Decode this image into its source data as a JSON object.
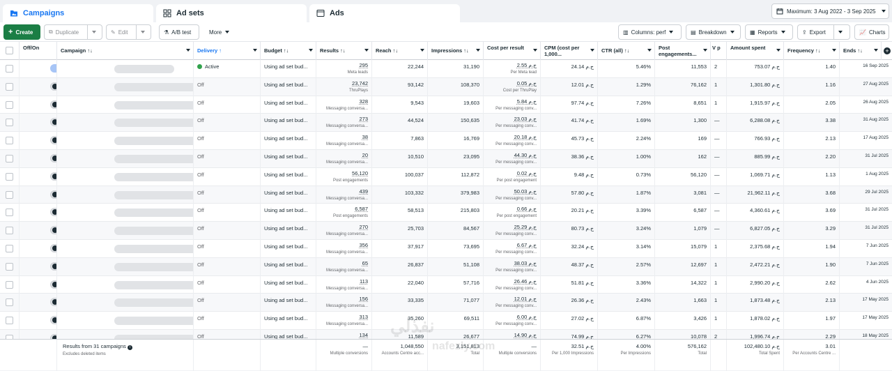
{
  "tabs": [
    {
      "label": "Campaigns",
      "icon": "folder-icon"
    },
    {
      "label": "Ad sets",
      "icon": "grid-icon"
    },
    {
      "label": "Ads",
      "icon": "ad-icon"
    }
  ],
  "date_range": "Maximum: 3 Aug 2022 - 3 Sep 2025",
  "toolbar": {
    "create": "Create",
    "duplicate": "Duplicate",
    "edit": "Edit",
    "ab_test": "A/B test",
    "more": "More",
    "columns": "Columns: perf",
    "breakdown": "Breakdown",
    "reports": "Reports",
    "export": "Export",
    "charts": "Charts"
  },
  "headers": {
    "offon": "Off/On",
    "campaign": "Campaign ↑↓",
    "delivery": "Delivery ↑",
    "budget": "Budget ↑↓",
    "results": "Results ↑↓",
    "reach": "Reach ↑↓",
    "impressions": "Impressions ↑↓",
    "cpr": "Cost per result",
    "cpm": "CPM (cost per 1,000...",
    "ctr": "CTR (all) ↑↓",
    "pe": "Post engagements...",
    "v": "V p",
    "spent": "Amount spent",
    "freq": "Frequency ↑↓",
    "ends": "Ends ↑↓"
  },
  "rows": [
    {
      "on": true,
      "delivery": "Active",
      "budget": "Using ad set bud...",
      "results": "295",
      "rsub": "Meta leads",
      "reach": "22,244",
      "impr": "31,190",
      "cpr": "2.55 ج.م",
      "cprsub": "Per Meta lead",
      "cpm": "24.14 ج.م",
      "ctr": "5.46%",
      "pe": "11,553",
      "v": "2",
      "spent": "753.07 ج.م",
      "freq": "1.40",
      "ends": "16 Sep 2025"
    },
    {
      "on": false,
      "delivery": "Off",
      "budget": "Using ad set bud...",
      "results": "23,742",
      "rsub": "ThruPlays",
      "reach": "93,142",
      "impr": "108,370",
      "cpr": "0.05 ج.م",
      "cprsub": "Cost per ThruPlay",
      "cpm": "12.01 ج.م",
      "ctr": "1.29%",
      "pe": "76,162",
      "v": "1",
      "spent": "1,301.80 ج.م",
      "freq": "1.16",
      "ends": "27 Aug 2025"
    },
    {
      "on": false,
      "delivery": "Off",
      "budget": "Using ad set bud...",
      "results": "328",
      "rsub": "Messaging conversa...",
      "reach": "9,543",
      "impr": "19,603",
      "cpr": "5.84 ج.م",
      "cprsub": "Per messaging conv...",
      "cpm": "97.74 ج.م",
      "ctr": "7.26%",
      "pe": "8,651",
      "v": "1",
      "spent": "1,915.97 ج.م",
      "freq": "2.05",
      "ends": "26 Aug 2025"
    },
    {
      "on": false,
      "delivery": "Off",
      "budget": "Using ad set bud...",
      "results": "273",
      "rsub": "Messaging conversa...",
      "reach": "44,524",
      "impr": "150,635",
      "cpr": "23.03 ج.م",
      "cprsub": "Per messaging conv...",
      "cpm": "41.74 ج.م",
      "ctr": "1.69%",
      "pe": "1,300",
      "v": "—",
      "spent": "6,288.08 ج.م",
      "freq": "3.38",
      "ends": "31 Aug 2025"
    },
    {
      "on": false,
      "delivery": "Off",
      "budget": "Using ad set bud...",
      "results": "38",
      "rsub": "Messaging conversa...",
      "reach": "7,863",
      "impr": "16,769",
      "cpr": "20.18 ج.م",
      "cprsub": "Per messaging conv...",
      "cpm": "45.73 ج.م",
      "ctr": "2.24%",
      "pe": "169",
      "v": "—",
      "spent": "766.93 ج.م",
      "freq": "2.13",
      "ends": "17 Aug 2025"
    },
    {
      "on": false,
      "delivery": "Off",
      "budget": "Using ad set bud...",
      "results": "20",
      "rsub": "Messaging conversa...",
      "reach": "10,510",
      "impr": "23,095",
      "cpr": "44.30 ج.م",
      "cprsub": "Per messaging conv...",
      "cpm": "38.36 ج.م",
      "ctr": "1.00%",
      "pe": "162",
      "v": "—",
      "spent": "885.99 ج.م",
      "freq": "2.20",
      "ends": "31 Jul 2025"
    },
    {
      "on": false,
      "delivery": "Off",
      "budget": "Using ad set bud...",
      "results": "56,120",
      "rsub": "Post engagements",
      "reach": "100,037",
      "impr": "112,872",
      "cpr": "0.02 ج.م",
      "cprsub": "Per post engagement",
      "cpm": "9.48 ج.م",
      "ctr": "0.73%",
      "pe": "56,120",
      "v": "—",
      "spent": "1,069.71 ج.م",
      "freq": "1.13",
      "ends": "1 Aug 2025"
    },
    {
      "on": false,
      "delivery": "Off",
      "budget": "Using ad set bud...",
      "results": "439",
      "rsub": "Messaging conversa...",
      "reach": "103,332",
      "impr": "379,983",
      "cpr": "50.03 ج.م",
      "cprsub": "Per messaging conv...",
      "cpm": "57.80 ج.م",
      "ctr": "1.87%",
      "pe": "3,081",
      "v": "—",
      "spent": "21,962.11 ج.م",
      "freq": "3.68",
      "ends": "29 Jul 2025"
    },
    {
      "on": false,
      "delivery": "Off",
      "budget": "Using ad set bud...",
      "results": "6,587",
      "rsub": "Post engagements",
      "reach": "58,513",
      "impr": "215,803",
      "cpr": "0.66 ج.م",
      "cprsub": "Per post engagement",
      "cpm": "20.21 ج.م",
      "ctr": "3.39%",
      "pe": "6,587",
      "v": "—",
      "spent": "4,360.61 ج.م",
      "freq": "3.69",
      "ends": "31 Jul 2025"
    },
    {
      "on": false,
      "delivery": "Off",
      "budget": "Using ad set bud...",
      "results": "270",
      "rsub": "Messaging conversa...",
      "reach": "25,703",
      "impr": "84,567",
      "cpr": "25.29 ج.م",
      "cprsub": "Per messaging conv...",
      "cpm": "80.73 ج.م",
      "ctr": "3.24%",
      "pe": "1,079",
      "v": "—",
      "spent": "6,827.05 ج.م",
      "freq": "3.29",
      "ends": "31 Jul 2025"
    },
    {
      "on": false,
      "delivery": "Off",
      "budget": "Using ad set bud...",
      "results": "356",
      "rsub": "Messaging conversa...",
      "reach": "37,917",
      "impr": "73,695",
      "cpr": "6.67 ج.م",
      "cprsub": "Per messaging conv...",
      "cpm": "32.24 ج.م",
      "ctr": "3.14%",
      "pe": "15,079",
      "v": "1",
      "spent": "2,375.68 ج.م",
      "freq": "1.94",
      "ends": "7 Jun 2025"
    },
    {
      "on": false,
      "delivery": "Off",
      "budget": "Using ad set bud...",
      "results": "65",
      "rsub": "Messaging conversa...",
      "reach": "26,837",
      "impr": "51,108",
      "cpr": "38.03 ج.م",
      "cprsub": "Per messaging conv...",
      "cpm": "48.37 ج.م",
      "ctr": "2.57%",
      "pe": "12,697",
      "v": "1",
      "spent": "2,472.21 ج.م",
      "freq": "1.90",
      "ends": "7 Jun 2025"
    },
    {
      "on": false,
      "delivery": "Off",
      "budget": "Using ad set bud...",
      "results": "113",
      "rsub": "Messaging conversa...",
      "reach": "22,040",
      "impr": "57,716",
      "cpr": "26.46 ج.م",
      "cprsub": "Per messaging conv...",
      "cpm": "51.81 ج.م",
      "ctr": "3.36%",
      "pe": "14,322",
      "v": "1",
      "spent": "2,990.20 ج.م",
      "freq": "2.62",
      "ends": "4 Jun 2025"
    },
    {
      "on": false,
      "delivery": "Off",
      "budget": "Using ad set bud...",
      "results": "156",
      "rsub": "Messaging conversa...",
      "reach": "33,335",
      "impr": "71,077",
      "cpr": "12.01 ج.م",
      "cprsub": "Per messaging conv...",
      "cpm": "26.36 ج.م",
      "ctr": "2.43%",
      "pe": "1,663",
      "v": "1",
      "spent": "1,873.48 ج.م",
      "freq": "2.13",
      "ends": "17 May 2025"
    },
    {
      "on": false,
      "delivery": "Off",
      "budget": "Using ad set bud...",
      "results": "313",
      "rsub": "Messaging conversa...",
      "reach": "35,260",
      "impr": "69,511",
      "cpr": "6.00 ج.م",
      "cprsub": "Per messaging conv...",
      "cpm": "27.02 ج.م",
      "ctr": "6.87%",
      "pe": "3,426",
      "v": "1",
      "spent": "1,878.02 ج.م",
      "freq": "1.97",
      "ends": "17 May 2025"
    },
    {
      "on": false,
      "delivery": "Off",
      "budget": "Using ad set bud...",
      "results": "134",
      "rsub": "",
      "reach": "11,589",
      "impr": "26,677",
      "cpr": "14.90 ج.م",
      "cprsub": "",
      "cpm": "74.99 ج.م",
      "ctr": "6.27%",
      "pe": "10,078",
      "v": "2",
      "spent": "1,996.74 ج.م",
      "freq": "2.29",
      "ends": "18 May 2025"
    }
  ],
  "footer": {
    "title": "Results from 31 campaigns",
    "subtitle": "Excludes deleted items",
    "results": "—",
    "results_sub": "Multiple conversions",
    "reach": "1,048,550",
    "reach_sub": "Accounts Centre acc...",
    "impr": "3,151,813",
    "impr_sub": "Total",
    "cpr": "—",
    "cpr_sub": "Multiple conversions",
    "cpm": "32.51 ج.م",
    "cpm_sub": "Per 1,000 Impressions",
    "ctr": "4.00%",
    "ctr_sub": "Per Impressions",
    "pe": "576,162",
    "pe_sub": "Total",
    "spent": "102,480.10 ج.م",
    "spent_sub": "Total Spent",
    "freq": "3.01",
    "freq_sub": "Per Accounts Centre ..."
  },
  "watermark": "نفذلي",
  "watermark_url": "nafezly.com",
  "colors": {
    "accent": "#1877f2",
    "create": "#1b7e45",
    "active_dot": "#31a24c"
  }
}
